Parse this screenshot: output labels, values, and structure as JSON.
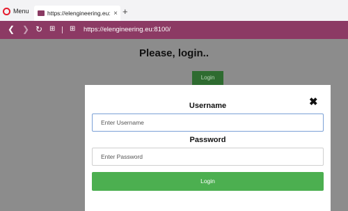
{
  "browser": {
    "menu_label": "Menu",
    "tab_title": "https://elengineering.eu:8",
    "tab_close": "×",
    "new_tab": "+",
    "url": "https://elengineering.eu:8100/",
    "accent": "#8c3a64"
  },
  "page": {
    "title": "Please, login..",
    "bg_login_label": "Login"
  },
  "modal": {
    "username_label": "Username",
    "username_placeholder": "Enter Username",
    "password_label": "Password",
    "password_placeholder": "Enter Password",
    "login_label": "Login",
    "close_glyph": "✖",
    "button_color": "#4caf50"
  }
}
